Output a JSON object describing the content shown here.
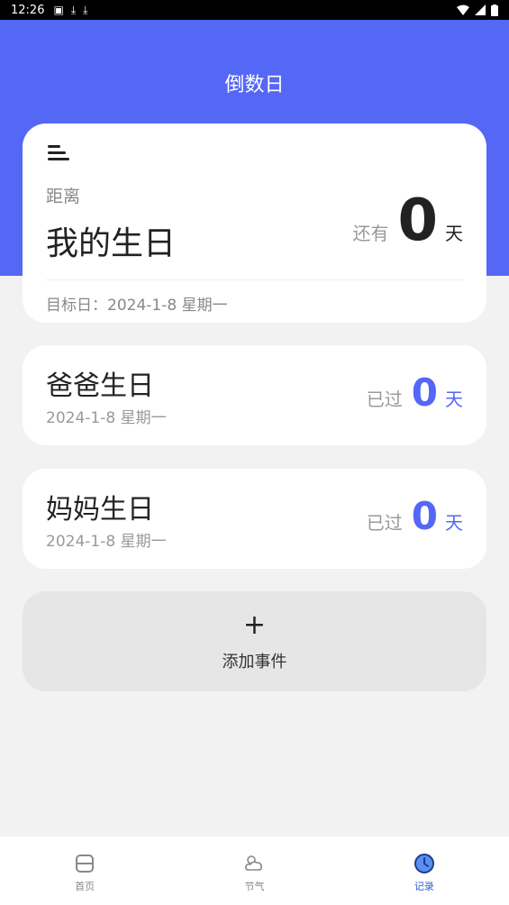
{
  "status_bar": {
    "time": "12:26"
  },
  "header": {
    "title": "倒数日"
  },
  "hero": {
    "label": "距离",
    "name": "我的生日",
    "remain_prefix": "还有",
    "days": "0",
    "unit": "天",
    "target": "目标日：2024-1-8 星期一"
  },
  "events": [
    {
      "name": "爸爸生日",
      "date": "2024-1-8 星期一",
      "prefix": "已过",
      "days": "0",
      "unit": "天"
    },
    {
      "name": "妈妈生日",
      "date": "2024-1-8 星期一",
      "prefix": "已过",
      "days": "0",
      "unit": "天"
    }
  ],
  "add": {
    "icon": "+",
    "label": "添加事件"
  },
  "tabs": [
    {
      "label": "首页",
      "icon": "home-icon"
    },
    {
      "label": "节气",
      "icon": "weather-icon"
    },
    {
      "label": "记录",
      "icon": "clock-icon",
      "active": true
    }
  ],
  "colors": {
    "primary": "#5567f5",
    "tab_active": "#2a5bd7"
  }
}
